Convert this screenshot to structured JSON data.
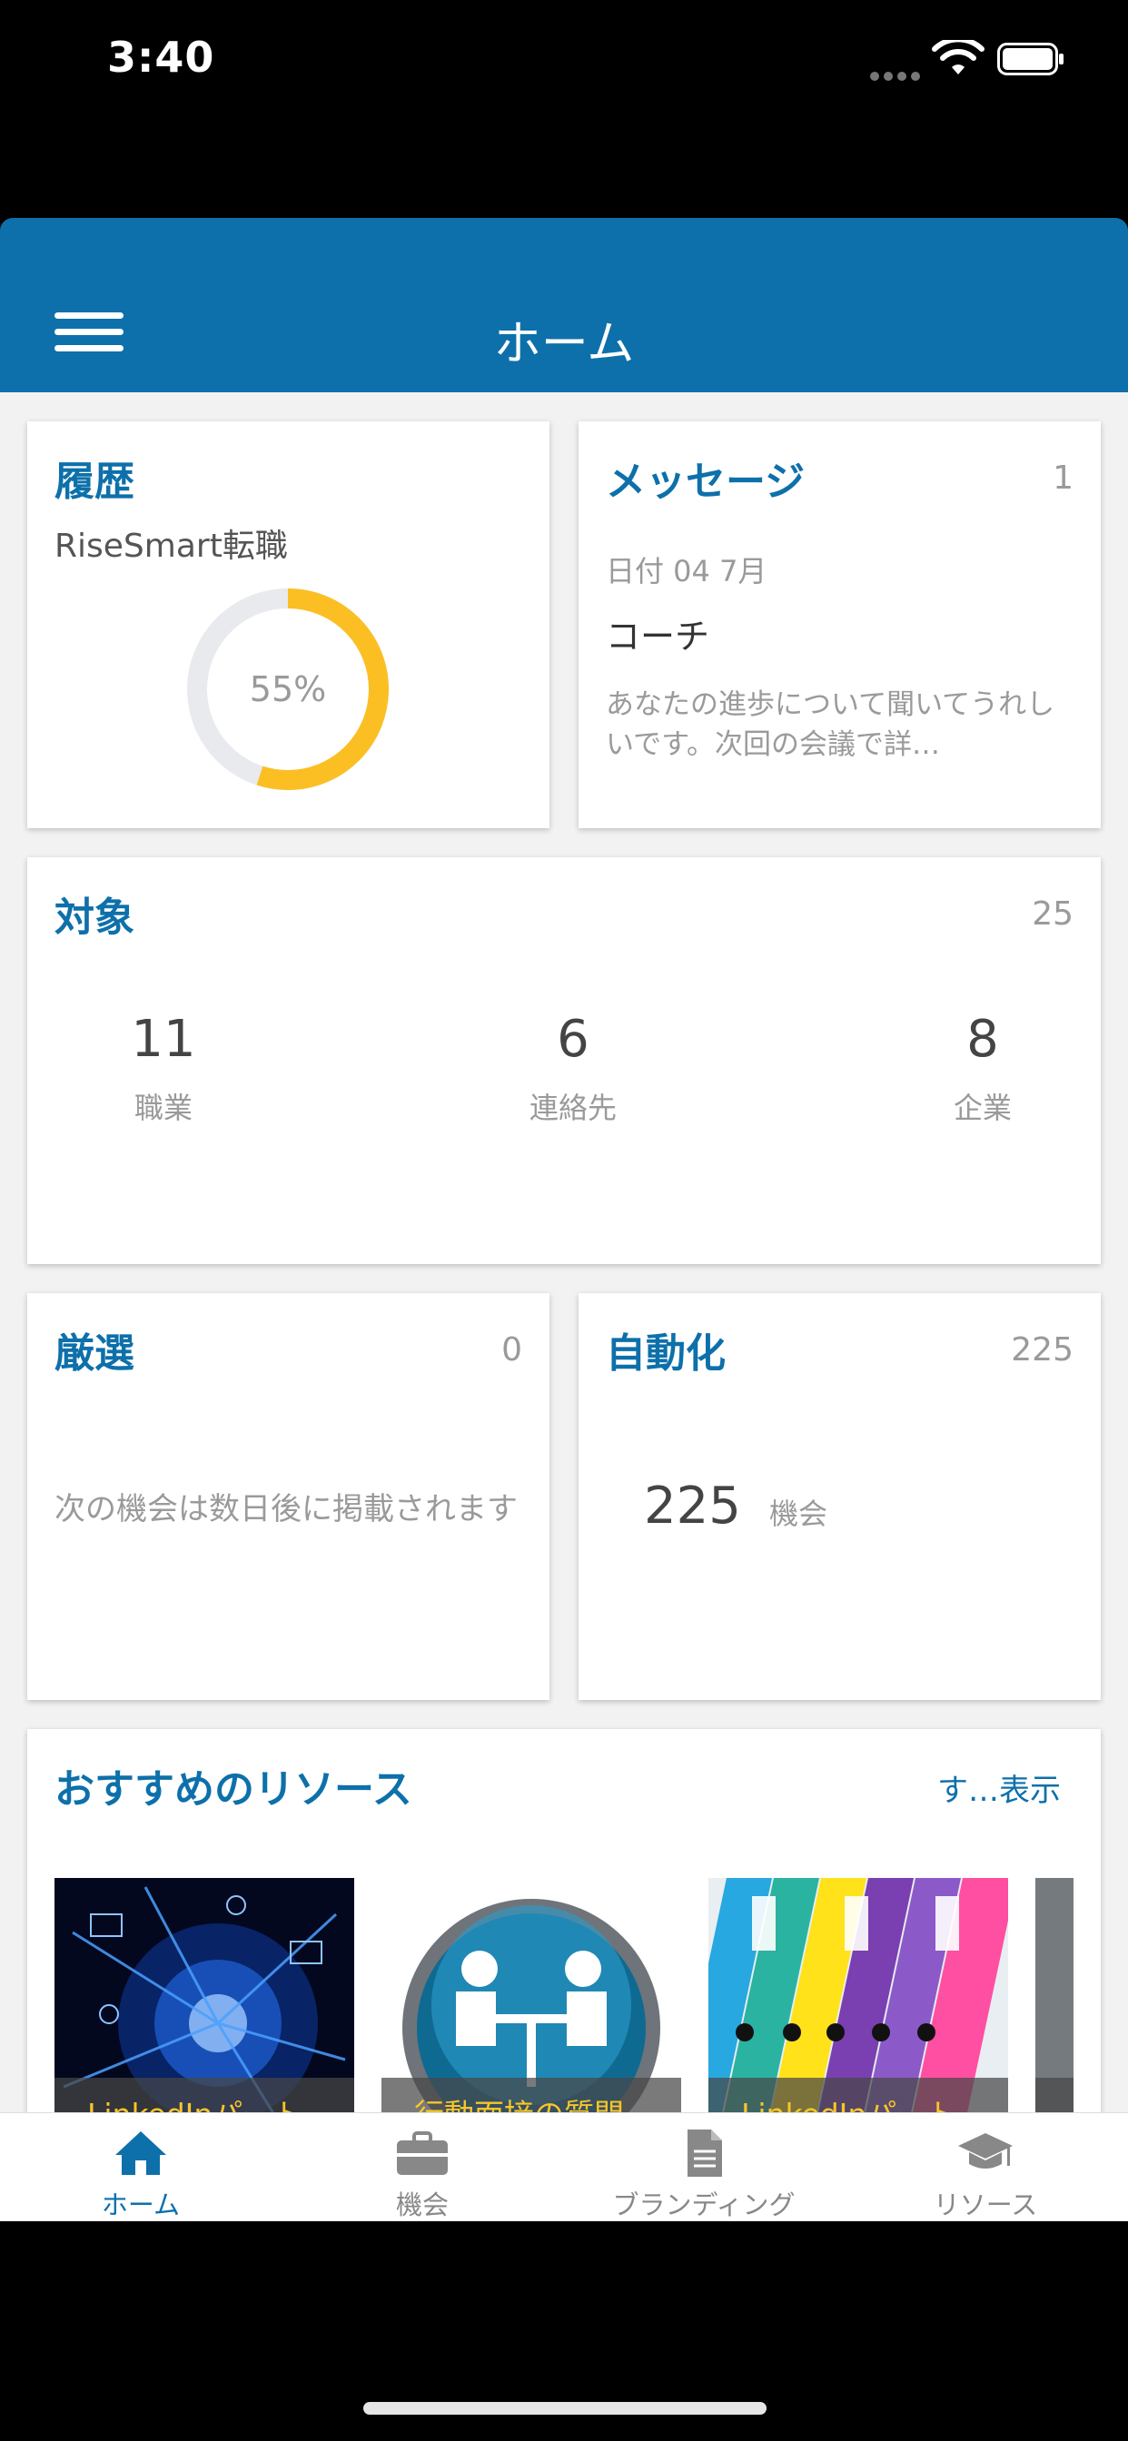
{
  "status_bar": {
    "time": "3:40"
  },
  "header": {
    "title": "ホーム"
  },
  "history": {
    "title": "履歴",
    "subtitle": "RiseSmart転職",
    "progress_percent": 55,
    "progress_label": "55%",
    "progress_color": "#fbbf24",
    "track_color": "#e8eaed"
  },
  "messages": {
    "title": "メッセージ",
    "count": "1",
    "date": "日付 04 7月",
    "sender": "コーチ",
    "preview": "あなたの進歩について聞いてうれしいです。次回の会議で詳…"
  },
  "targets": {
    "title": "対象",
    "count": "25",
    "stats": [
      {
        "value": "11",
        "label": "職業"
      },
      {
        "value": "6",
        "label": "連絡先"
      },
      {
        "value": "8",
        "label": "企業"
      }
    ]
  },
  "curated": {
    "title": "厳選",
    "count": "0",
    "message": "次の機会は数日後に掲載されます"
  },
  "automated": {
    "title": "自動化",
    "count": "225",
    "value": "225",
    "label": "機会"
  },
  "resources": {
    "title": "おすすめのリソース",
    "see_all": "す…表示",
    "items": [
      {
        "caption": "LinkedInパート",
        "image": "network-globe-image"
      },
      {
        "caption": "行動面接の質問",
        "image": "interview-meeting-image"
      },
      {
        "caption": "LinkedInパート",
        "image": "binders-image"
      }
    ]
  },
  "tabs": [
    {
      "label": "ホーム",
      "icon": "home-icon",
      "active": true
    },
    {
      "label": "機会",
      "icon": "briefcase-icon",
      "active": false
    },
    {
      "label": "ブランディング",
      "icon": "document-icon",
      "active": false
    },
    {
      "label": "リソース",
      "icon": "graduation-cap-icon",
      "active": false
    }
  ],
  "colors": {
    "primary": "#0d70aa",
    "accent": "#fbbf24",
    "caption": "#f7c62a"
  }
}
